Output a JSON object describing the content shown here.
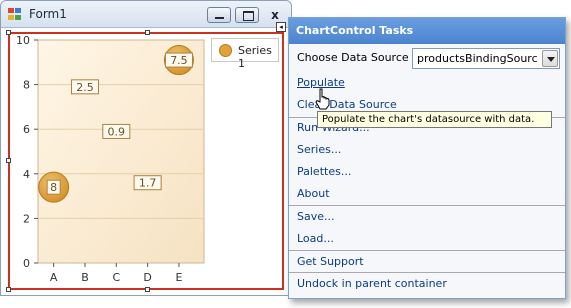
{
  "window": {
    "title": "Form1",
    "close_glyph": "x"
  },
  "chart_data": {
    "type": "bubble",
    "categories": [
      "A",
      "B",
      "C",
      "D",
      "E"
    ],
    "ylim": [
      0,
      10
    ],
    "yticks": [
      0,
      2,
      4,
      6,
      8,
      10
    ],
    "series": [
      {
        "name": "Series 1",
        "color": "#e1a23b",
        "points": [
          {
            "x": "A",
            "y": 3.4,
            "weight": 8,
            "label": "8"
          },
          {
            "x": "B",
            "y": 7.9,
            "weight": 2.5,
            "label": "2.5"
          },
          {
            "x": "C",
            "y": 5.9,
            "weight": 0.9,
            "label": "0.9"
          },
          {
            "x": "D",
            "y": 3.6,
            "weight": 1.7,
            "label": "1.7"
          },
          {
            "x": "E",
            "y": 9.1,
            "weight": 7.5,
            "label": "7.5"
          }
        ]
      }
    ],
    "legend": "top-right",
    "grid": true
  },
  "legend": {
    "label": "Series 1"
  },
  "tasks": {
    "header": "ChartControl Tasks",
    "data_source_label": "Choose Data Source",
    "data_source_value": "productsBindingSourc",
    "items": [
      {
        "label": "Populate"
      },
      {
        "label": "Clear Data Source"
      },
      {
        "label": "Run Wizard..."
      },
      {
        "label": "Series..."
      },
      {
        "label": "Palettes..."
      },
      {
        "label": "About"
      },
      {
        "label": "Save..."
      },
      {
        "label": "Load..."
      },
      {
        "label": "Get Support"
      },
      {
        "label": "Undock in parent container"
      }
    ]
  },
  "tooltip": {
    "text": "Populate the chart's datasource with data."
  }
}
